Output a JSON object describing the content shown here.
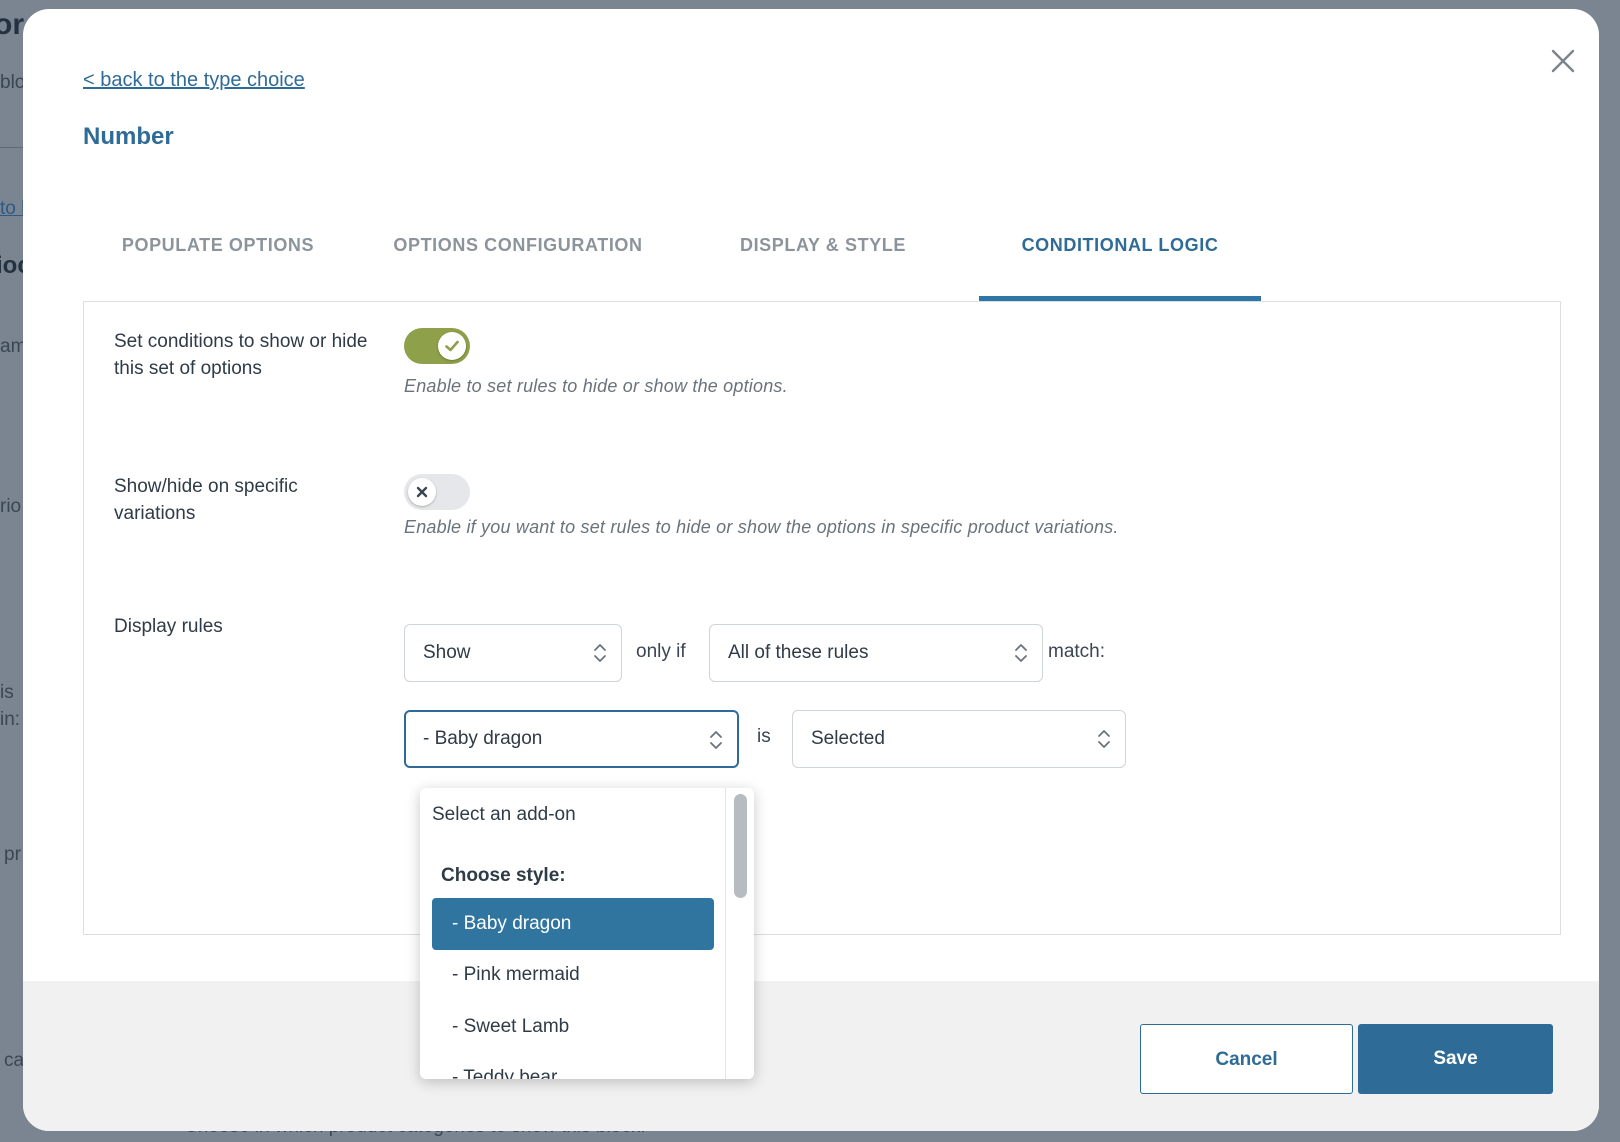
{
  "background": {
    "fragments": [
      "or",
      "blo",
      "to l",
      "ioc",
      "am",
      "rio",
      "is",
      "in:",
      "pr",
      "ca"
    ],
    "bottom_text": "Choose in which product categories to show this block."
  },
  "modal": {
    "back_link": "< back to the type choice",
    "title": "Number",
    "tabs": [
      "POPULATE OPTIONS",
      "OPTIONS CONFIGURATION",
      "DISPLAY & STYLE",
      "CONDITIONAL LOGIC"
    ],
    "active_tab": "CONDITIONAL LOGIC",
    "conditions": {
      "label": "Set conditions to show or hide this set of options",
      "enabled": true,
      "hint": "Enable to set rules to hide or show the options."
    },
    "variations": {
      "label": "Show/hide on specific variations",
      "enabled": false,
      "hint": "Enable if you want to set rules to hide or show the options in specific product variations."
    },
    "display_rules": {
      "label": "Display rules",
      "show_select": "Show",
      "only_if": "only if",
      "match_select": "All of these rules",
      "match_suffix": "match:",
      "addon_select": "- Baby dragon",
      "is_text": "is",
      "state_select": "Selected"
    },
    "dropdown": {
      "placeholder": "Select an add-on",
      "group_label": "Choose style:",
      "options": [
        "- Baby dragon",
        "- Pink mermaid",
        "- Sweet Lamb",
        "- Teddy bear"
      ],
      "selected": "- Baby dragon"
    },
    "footer": {
      "cancel": "Cancel",
      "save": "Save"
    }
  },
  "colors": {
    "accent": "#2f6b97",
    "toggle_on": "#8ea04a",
    "overlay": "#7a8591"
  }
}
